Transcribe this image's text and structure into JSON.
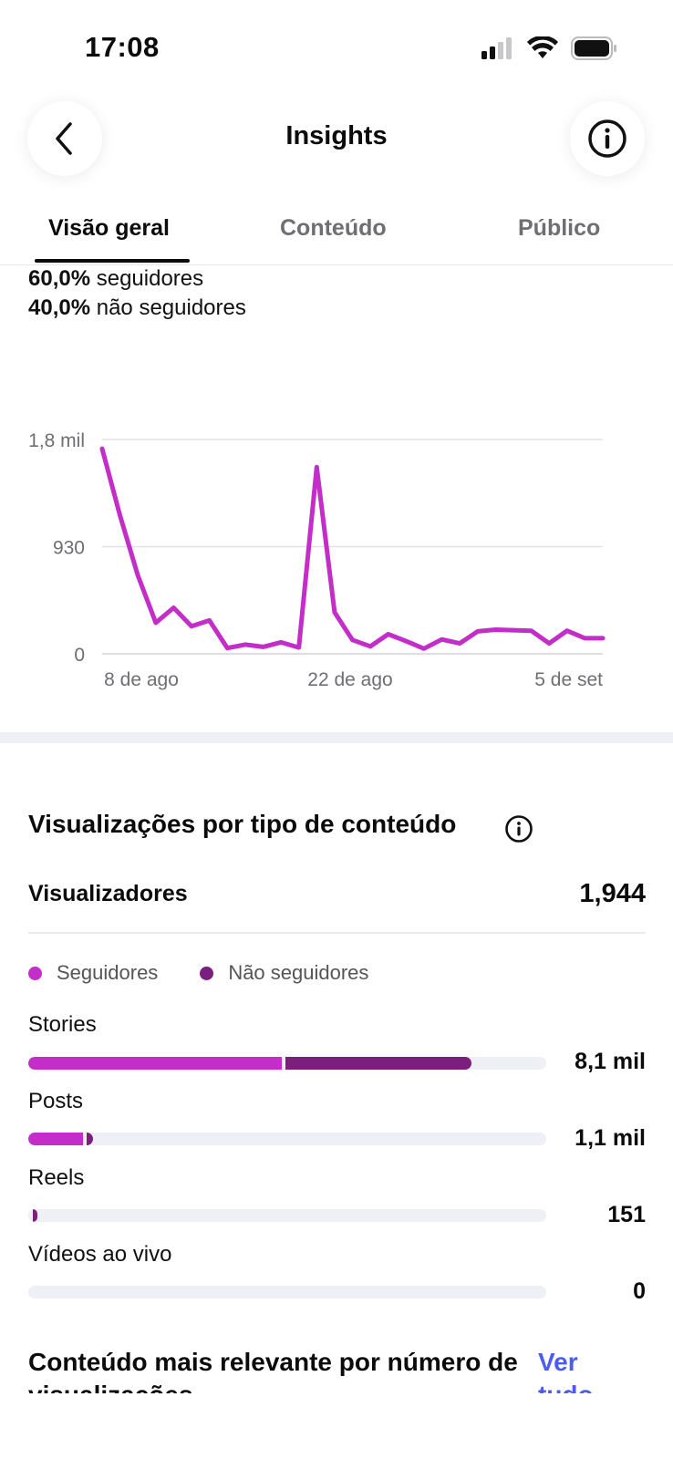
{
  "status_bar": {
    "time": "17:08"
  },
  "header": {
    "title": "Insights",
    "back_icon": "chevron-left-icon",
    "info_icon": "info-icon"
  },
  "tabs": [
    {
      "label": "Visão geral",
      "active": true
    },
    {
      "label": "Conteúdo",
      "active": false
    },
    {
      "label": "Público",
      "active": false
    }
  ],
  "audience_split": {
    "followers_pct": "60,0%",
    "followers_label": "seguidores",
    "nonfollowers_pct": "40,0%",
    "nonfollowers_label": "não seguidores"
  },
  "chart_data": {
    "type": "line",
    "color": "#c32dc8",
    "y_ticks": [
      "1,8 mil",
      "930",
      "0"
    ],
    "ylim": [
      0,
      1860
    ],
    "x_ticks": [
      "8 de ago",
      "22 de ago",
      "5 de set"
    ],
    "series": [
      {
        "values": [
          1780,
          1200,
          680,
          270,
          400,
          240,
          290,
          50,
          80,
          60,
          100,
          55,
          1620,
          360,
          120,
          65,
          170,
          110,
          45,
          125,
          90,
          195,
          210,
          205,
          200,
          90,
          200,
          135,
          135
        ]
      }
    ]
  },
  "content_views": {
    "title": "Visualizações por tipo de conteúdo",
    "viewers_label": "Visualizadores",
    "viewers_value": "1,944",
    "legend": [
      {
        "label": "Seguidores",
        "color": "#c32dc8"
      },
      {
        "label": "Não seguidores",
        "color": "#7a1f7e"
      }
    ],
    "rows": [
      {
        "label": "Stories",
        "value": "8,1 mil",
        "followers_fraction": 0.49,
        "nonfollowers_fraction": 0.365
      },
      {
        "label": "Posts",
        "value": "1,1 mil",
        "followers_fraction": 0.105,
        "nonfollowers_fraction": 0.02
      },
      {
        "label": "Reels",
        "value": "151",
        "followers_fraction": 0.0,
        "nonfollowers_fraction": 0.018
      },
      {
        "label": "Vídeos ao vivo",
        "value": "0",
        "followers_fraction": 0.0,
        "nonfollowers_fraction": 0.0
      }
    ]
  },
  "top_content": {
    "title": "Conteúdo mais relevante por número de visualizações",
    "see_all": "Ver tudo"
  }
}
